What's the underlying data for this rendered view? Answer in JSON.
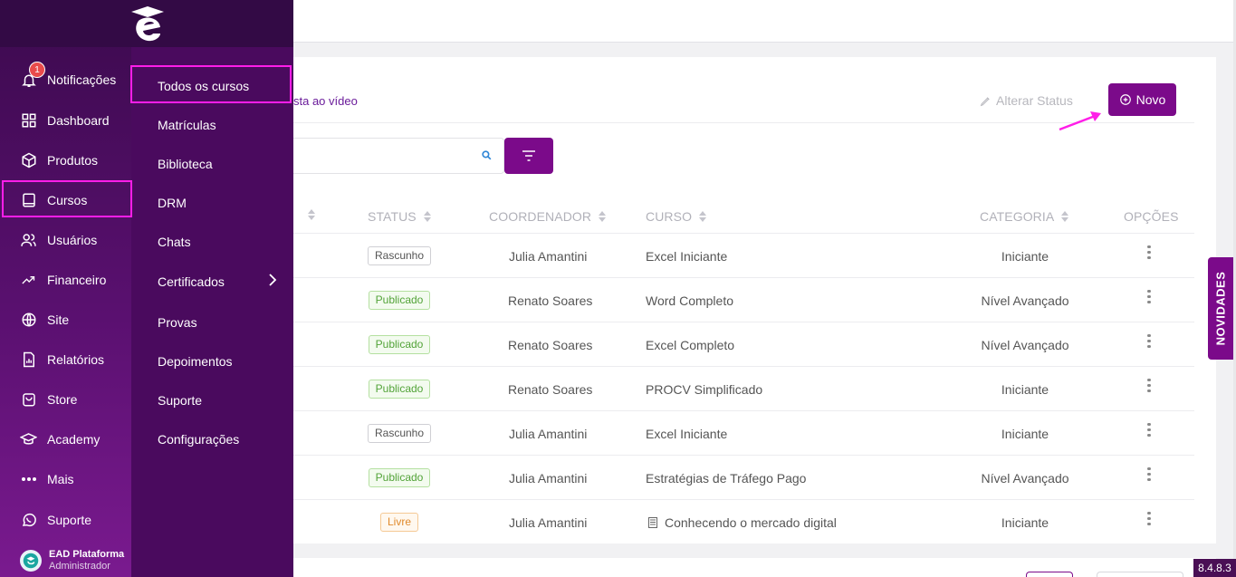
{
  "sidebar": {
    "items": [
      {
        "label": "Notificações",
        "icon": "bell-icon"
      },
      {
        "label": "Dashboard",
        "icon": "grid-icon"
      },
      {
        "label": "Produtos",
        "icon": "box-icon"
      },
      {
        "label": "Cursos",
        "icon": "book-icon"
      },
      {
        "label": "Usuários",
        "icon": "users-icon"
      },
      {
        "label": "Financeiro",
        "icon": "trending-icon"
      },
      {
        "label": "Site",
        "icon": "globe-icon"
      },
      {
        "label": "Relatórios",
        "icon": "report-icon"
      },
      {
        "label": "Store",
        "icon": "bag-icon"
      },
      {
        "label": "Academy",
        "icon": "graduation-icon"
      },
      {
        "label": "Mais",
        "icon": "more-icon"
      },
      {
        "label": "Suporte",
        "icon": "whatsapp-icon"
      }
    ],
    "notification_count": "1",
    "user": {
      "name": "EAD Plataforma",
      "role": "Administrador"
    }
  },
  "submenu": {
    "items": [
      "Todos os cursos",
      "Matrículas",
      "Biblioteca",
      "DRM",
      "Chats",
      "Certificados",
      "Provas",
      "Depoimentos",
      "Suporte",
      "Configurações"
    ]
  },
  "toolbar": {
    "video_link": "sta ao vídeo",
    "alter_status": "Alterar Status",
    "novo": "Novo"
  },
  "table": {
    "headers": [
      "STATUS",
      "COORDENADOR",
      "CURSO",
      "CATEGORIA",
      "OPÇÕES"
    ],
    "rows": [
      {
        "status": "Rascunho",
        "coordenador": "Julia Amantini",
        "curso": "Excel Iniciante",
        "categoria": "Iniciante"
      },
      {
        "status": "Publicado",
        "coordenador": "Renato Soares",
        "curso": "Word Completo",
        "categoria": "Nível Avançado"
      },
      {
        "status": "Publicado",
        "coordenador": "Renato Soares",
        "curso": "Excel Completo",
        "categoria": "Nível Avançado"
      },
      {
        "status": "Publicado",
        "coordenador": "Renato Soares",
        "curso": "PROCV Simplificado",
        "categoria": "Iniciante"
      },
      {
        "status": "Rascunho",
        "coordenador": "Julia Amantini",
        "curso": "Excel Iniciante",
        "categoria": "Iniciante"
      },
      {
        "status": "Publicado",
        "coordenador": "Julia Amantini",
        "curso": "Estratégias de Tráfego Pago",
        "categoria": "Nível Avançado"
      },
      {
        "status": "Livre",
        "coordenador": "Julia Amantini",
        "curso": "Conhecendo o mercado digital",
        "categoria": "Iniciante"
      }
    ]
  },
  "novidades": "NOVIDADES",
  "version": "8.4.8.3",
  "colors": {
    "brand": "#7b0a8a",
    "highlight": "#ff1ee8"
  }
}
